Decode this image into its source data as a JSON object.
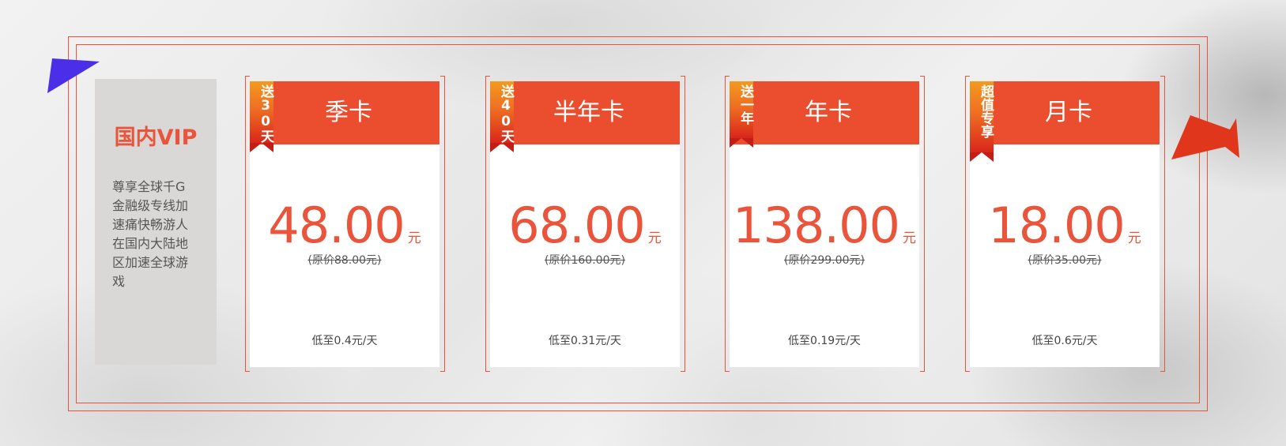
{
  "panel": {
    "title": "国内VIP",
    "description": "尊享全球千G金融级专线加速痛快畅游人在国内大陆地区加速全球游戏"
  },
  "plans": [
    {
      "name": "季卡",
      "ribbon": "送30天",
      "price": "48.00",
      "unit": "元",
      "original": "(原价88.00元)",
      "daily": "低至0.4元/天"
    },
    {
      "name": "半年卡",
      "ribbon": "送40天",
      "price": "68.00",
      "unit": "元",
      "original": "(原价160.00元)",
      "daily": "低至0.31元/天"
    },
    {
      "name": "年卡",
      "ribbon": "送一年",
      "price": "138.00",
      "unit": "元",
      "original": "(原价299.00元)",
      "daily": "低至0.19元/天"
    },
    {
      "name": "月卡",
      "ribbon": "超值专享",
      "price": "18.00",
      "unit": "元",
      "original": "(原价35.00元)",
      "daily": "低至0.6元/天"
    }
  ],
  "colors": {
    "accent": "#ea4e2f",
    "ribbon_top": "#f39a1f",
    "ribbon_bottom": "#d9261a",
    "flag_left": "#4b2fe8",
    "flag_right": "#e0361c",
    "panel_bg": "#d9d8d7"
  },
  "icons": {
    "left_flag": "pennant-flag-icon",
    "right_flag": "pennant-flag-icon"
  }
}
